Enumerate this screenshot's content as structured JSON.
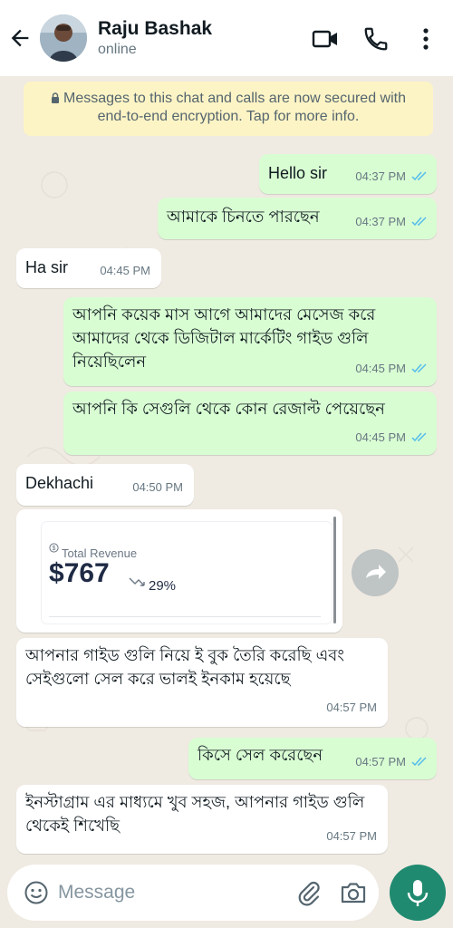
{
  "header": {
    "contact_name": "Raju Bashak",
    "status": "online",
    "icons": [
      "back-arrow-icon",
      "video-call-icon",
      "phone-icon",
      "more-vertical-icon"
    ]
  },
  "encryption_notice": "Messages to this chat and calls are now secured with end-to-end encryption. Tap for more info.",
  "messages": [
    {
      "dir": "out",
      "text": "Hello sir",
      "time": "04:37 PM",
      "read": true
    },
    {
      "dir": "out",
      "text": "আমাকে চিনতে পারছেন",
      "time": "04:37 PM",
      "read": true
    },
    {
      "dir": "in",
      "text": "Ha sir",
      "time": "04:45 PM"
    },
    {
      "dir": "out",
      "text": "আপনি কয়েক মাস আগে আমাদের মেসেজ করে আমাদের থেকে ডিজিটাল মার্কেটিং গাইড গুলি নিয়েছিলেন",
      "time": "04:45 PM",
      "read": true
    },
    {
      "dir": "out",
      "text": "আপনি কি সেগুলি থেকে কোন রেজাল্ট পেয়েছেন",
      "time": "04:45 PM",
      "read": true
    },
    {
      "dir": "in",
      "text": "Dekhachi",
      "time": "04:50 PM"
    },
    {
      "dir": "in",
      "type": "image",
      "card": {
        "label": "Total Revenue",
        "value": "$767",
        "change": "29%"
      }
    },
    {
      "dir": "in",
      "text": "আপনার গাইড গুলি নিয়ে ই বুক তৈরি করেছি এবং সেইগুলো সেল করে ভালই ইনকাম হয়েছে",
      "time": "04:57 PM"
    },
    {
      "dir": "out",
      "text": "কিসে সেল করেছেন",
      "time": "04:57 PM",
      "read": true
    },
    {
      "dir": "in",
      "text": "ইনস্টাগ্রাম এর মাধ্যমে খুব সহজ, আপনার গাইড গুলি থেকেই শিখেছি",
      "time": "04:57 PM"
    }
  ],
  "composer": {
    "placeholder": "Message",
    "icons": [
      "emoji-icon",
      "paperclip-icon",
      "camera-icon",
      "mic-icon"
    ]
  },
  "colors": {
    "outgoing_bubble": "#d9fdd3",
    "incoming_bubble": "#ffffff",
    "chat_background": "#efeae2",
    "read_ticks": "#53bdeb",
    "mic_button": "#1f8a70",
    "encryption_banner": "#fdf4c5"
  }
}
